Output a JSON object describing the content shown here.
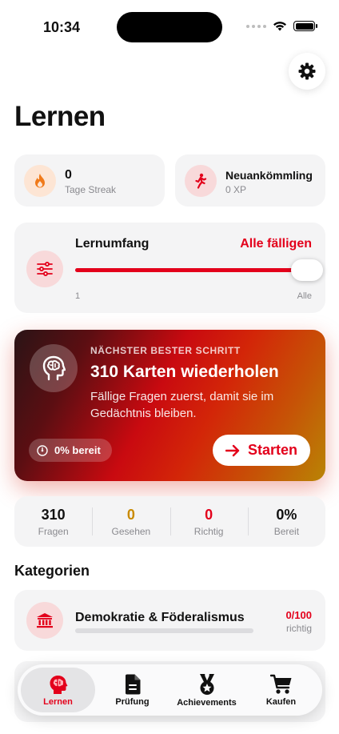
{
  "status": {
    "time": "10:34"
  },
  "page": {
    "title": "Lernen"
  },
  "streak": {
    "value": "0",
    "label": "Tage Streak"
  },
  "rank": {
    "name": "Neuankömmling",
    "xp": "0 XP"
  },
  "learning_scope": {
    "title": "Lernumfang",
    "value": "Alle fälligen",
    "slider_level": 1.0,
    "min_label": "1",
    "max_label": "Alle"
  },
  "hero": {
    "eyebrow": "NÄCHSTER BESTER SCHRITT",
    "title": "310 Karten wiederholen",
    "description": "Fällige Fragen zuerst, damit sie im Gedächtnis bleiben.",
    "badge": "0% bereit",
    "button": "Starten"
  },
  "stats": [
    {
      "value": "310",
      "label": "Fragen",
      "color": "#111111"
    },
    {
      "value": "0",
      "label": "Gesehen",
      "color": "#c98a00"
    },
    {
      "value": "0",
      "label": "Richtig",
      "color": "#e3001b"
    },
    {
      "value": "0%",
      "label": "Bereit",
      "color": "#111111"
    }
  ],
  "categories_section": {
    "title": "Kategorien",
    "items": [
      {
        "title": "Demokratie & Föderalismus",
        "score": "0/100",
        "score_sub": "richtig",
        "progress": 0,
        "icon": "institution-icon"
      }
    ]
  },
  "tabs": [
    {
      "label": "Lernen",
      "icon": "brain-icon",
      "active": true
    },
    {
      "label": "Prüfung",
      "icon": "document-icon",
      "active": false
    },
    {
      "label": "Achievements",
      "icon": "medal-icon",
      "active": false
    },
    {
      "label": "Kaufen",
      "icon": "cart-icon",
      "active": false
    }
  ],
  "colors": {
    "accent": "#e3001b",
    "card": "#f4f4f5"
  }
}
